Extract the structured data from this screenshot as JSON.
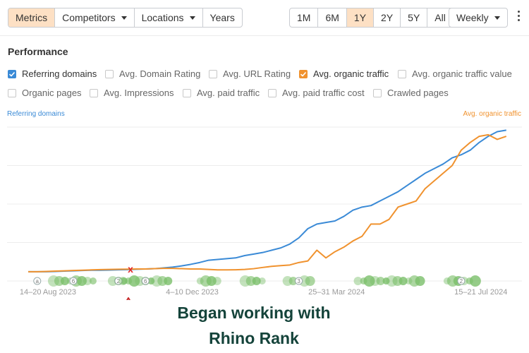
{
  "toolbar": {
    "tabs": [
      {
        "label": "Metrics",
        "active": true
      },
      {
        "label": "Competitors",
        "dropdown": true
      },
      {
        "label": "Locations",
        "dropdown": true
      },
      {
        "label": "Years"
      }
    ],
    "ranges": [
      {
        "label": "1M"
      },
      {
        "label": "6M"
      },
      {
        "label": "1Y",
        "active": true
      },
      {
        "label": "2Y"
      },
      {
        "label": "5Y"
      },
      {
        "label": "All"
      }
    ],
    "interval": "Weekly",
    "more_icon": "kebab-menu-icon"
  },
  "section_title": "Performance",
  "metrics": [
    {
      "label": "Referring domains",
      "checked": true,
      "color": "#3a8ad6"
    },
    {
      "label": "Avg. Domain Rating",
      "checked": false
    },
    {
      "label": "Avg. URL Rating",
      "checked": false
    },
    {
      "label": "Avg. organic traffic",
      "checked": true,
      "color": "#f0922e"
    },
    {
      "label": "Avg. organic traffic value",
      "checked": false
    },
    {
      "label": "Organic pages",
      "checked": false
    },
    {
      "label": "Avg. Impressions",
      "checked": false
    },
    {
      "label": "Avg. paid traffic",
      "checked": false
    },
    {
      "label": "Avg. paid traffic cost",
      "checked": false
    },
    {
      "label": "Crawled pages",
      "checked": false
    }
  ],
  "chart_data": {
    "type": "line",
    "left_axis_label": "Referring domains",
    "right_axis_label": "Avg. organic traffic",
    "x_tick_labels": [
      "14–20 Aug 2023",
      "4–10 Dec 2023",
      "25–31 Mar 2024",
      "15–21 Jul 2024"
    ],
    "x_range_weeks": [
      0,
      52
    ],
    "grid": true,
    "series": [
      {
        "name": "Referring domains",
        "color": "#3a8ad6",
        "values": [
          0.06,
          0.06,
          0.06,
          0.062,
          0.064,
          0.066,
          0.068,
          0.07,
          0.07,
          0.071,
          0.073,
          0.074,
          0.076,
          0.078,
          0.08,
          0.085,
          0.09,
          0.098,
          0.108,
          0.12,
          0.135,
          0.14,
          0.145,
          0.15,
          0.165,
          0.175,
          0.185,
          0.2,
          0.215,
          0.24,
          0.28,
          0.34,
          0.37,
          0.38,
          0.39,
          0.42,
          0.46,
          0.48,
          0.49,
          0.52,
          0.55,
          0.58,
          0.62,
          0.66,
          0.7,
          0.73,
          0.76,
          0.8,
          0.82,
          0.85,
          0.9,
          0.94,
          0.97,
          0.98
        ]
      },
      {
        "name": "Avg. organic traffic",
        "color": "#f0922e",
        "values": [
          0.06,
          0.06,
          0.062,
          0.064,
          0.066,
          0.068,
          0.07,
          0.072,
          0.074,
          0.075,
          0.076,
          0.077,
          0.078,
          0.078,
          0.08,
          0.082,
          0.082,
          0.08,
          0.078,
          0.078,
          0.075,
          0.072,
          0.072,
          0.073,
          0.075,
          0.08,
          0.088,
          0.095,
          0.1,
          0.104,
          0.12,
          0.13,
          0.2,
          0.15,
          0.19,
          0.22,
          0.26,
          0.29,
          0.37,
          0.37,
          0.4,
          0.48,
          0.5,
          0.52,
          0.6,
          0.65,
          0.7,
          0.75,
          0.85,
          0.9,
          0.94,
          0.95,
          0.92,
          0.94
        ]
      }
    ],
    "event_markers": [
      {
        "week": 1,
        "label": "a",
        "count": 1
      },
      {
        "week": 5,
        "label": "6",
        "count": 8
      },
      {
        "week": 10,
        "label": "2",
        "count": 3
      },
      {
        "week": 13,
        "label": "6",
        "count": 9
      },
      {
        "week": 20,
        "label": "",
        "count": 4
      },
      {
        "week": 25,
        "label": "",
        "count": 4
      },
      {
        "week": 30,
        "label": "3",
        "count": 5
      },
      {
        "week": 40,
        "label": "",
        "count": 12
      },
      {
        "week": 48,
        "label": "2",
        "count": 6
      }
    ],
    "event_marker_color": "#7bbf6a"
  },
  "annotation": {
    "mark": "x",
    "line1": "Began working with",
    "line2": "Rhino Rank"
  }
}
